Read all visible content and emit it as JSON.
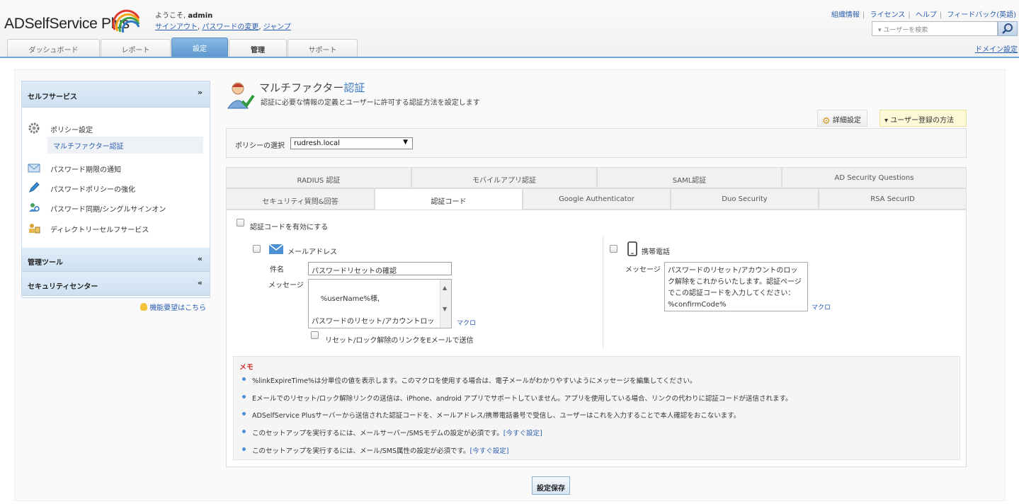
{
  "header": {
    "logo_text": "ADSelfService Plus",
    "welcome_prefix": "ようこそ,",
    "username": "admin",
    "signout": "サインアウト",
    "change_password": "パスワードの変更",
    "jump": "ジャンプ",
    "toplinks": [
      "組織情報",
      "ライセンス",
      "ヘルプ",
      "フィードバック(英語)"
    ],
    "search_placeholder": "▾ ユーザーを検索",
    "domain_settings": "ドメイン設定"
  },
  "tabs": [
    {
      "label": "ダッシュボード"
    },
    {
      "label": "レポート"
    },
    {
      "label": "設定",
      "active": true
    },
    {
      "label": "管理"
    },
    {
      "label": "サポート"
    }
  ],
  "sidebar": {
    "self_service": "セルフサービス",
    "items": [
      {
        "label": "ポリシー設定",
        "icon": "gear-icon"
      },
      {
        "label": "パスワード期限の通知",
        "icon": "mail-icon"
      },
      {
        "label": "パスワードポリシーの強化",
        "icon": "pen-icon"
      },
      {
        "label": "パスワード同期/シングルサインオン",
        "icon": "sync-users-icon"
      },
      {
        "label": "ディレクトリーセルフサービス",
        "icon": "directory-icon"
      }
    ],
    "sub_item": "マルチファクター認証",
    "admin_tools": "管理ツール",
    "security_center": "セキュリティセンター",
    "feature_request": "機能要望はこちら"
  },
  "content": {
    "title_a": "マルチファクター",
    "title_b": "認証",
    "description": "認証に必要な情報の定義とユーザーに許可する認証方法を設定します",
    "advanced_btn": "詳細設定",
    "registration_btn": "▾ ユーザー登録の方法",
    "policy_label": "ポリシーの選択",
    "policy_value": "rudresh.local"
  },
  "auth_tabs_row1": [
    "RADIUS 認証",
    "モバイルアプリ認証",
    "SAML認証",
    "AD Security Questions"
  ],
  "auth_tabs_row2": [
    "セキュリティ質問&回答",
    "認証コード",
    "Google Authenticator",
    "Duo Security",
    "RSA SecurID"
  ],
  "panel": {
    "enable_label": "認証コードを有効にする",
    "email_label": "メールアドレス",
    "subject_label": "件名",
    "subject_value": "パスワードリセットの確認",
    "message_label": "メッセージ",
    "email_message": "%userName%様,\n\nパスワードのリセット/アカウントロックを解除します。本人確認のために、この認証コードを入力してください：",
    "macro": "マクロ",
    "send_link_label": "リセット/ロック解除のリンクをEメールで送信",
    "mobile_label": "携帯電話",
    "mobile_message_label": "メッセージ",
    "mobile_message": "パスワードのリセット/アカウントのロック解除をこれからいたします。認証ページでこの認証コードを入力してください：%confirmCode%",
    "mobile_macro": "マクロ"
  },
  "notes": {
    "title": "メモ",
    "items": [
      {
        "text": "%linkExpireTime%は分単位の値を表示します。このマクロを使用する場合は、電子メールがわかりやすいようにメッセージを編集してください。"
      },
      {
        "text": "Eメールでのリセット/ロック解除リンクの送信は、iPhone、android アプリでサポートしていません。アプリを使用している場合、リンクの代わりに認証コードが送信されます。"
      },
      {
        "text": "ADSelfService Plusサーバーから送信された認証コードを、メールアドレス/携帯電話番号で受信し、ユーザーはこれを入力することで本人確認をおこないます。"
      },
      {
        "text": "このセットアップを実行するには、メールサーバー/SMSモデムの設定が必須です。",
        "link": "[今すぐ設定]"
      },
      {
        "text": "このセットアップを実行するには、メール/SMS属性の設定が必須です。",
        "link": "[今すぐ設定]"
      }
    ]
  },
  "save_label": "設定保存"
}
